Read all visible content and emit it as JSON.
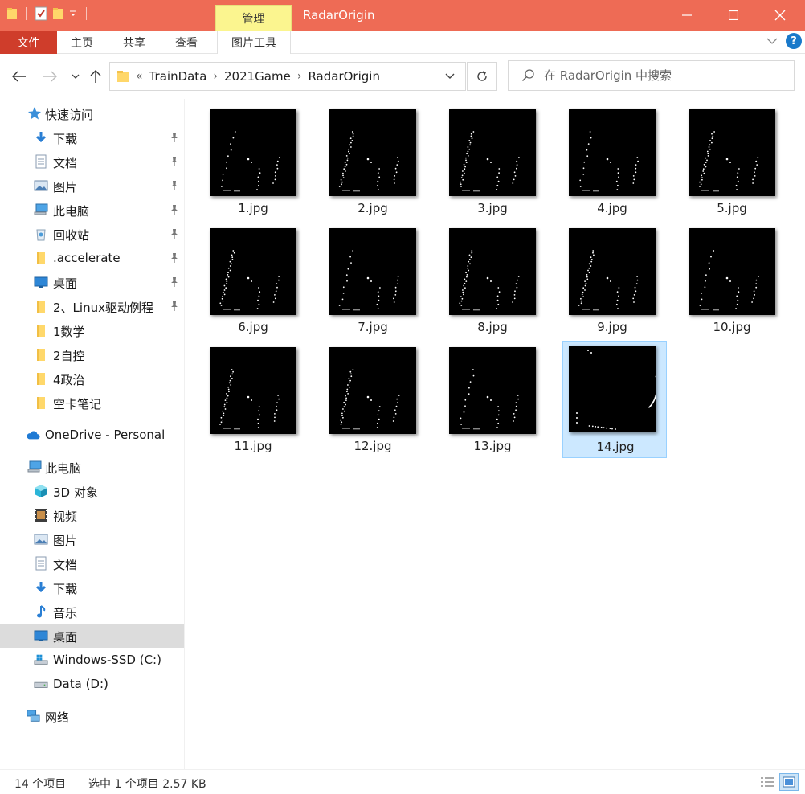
{
  "window": {
    "title": "RadarOrigin",
    "context_tab": "管理",
    "accent": "#ee6b55"
  },
  "ribbon": {
    "file_label": "文件",
    "tabs": [
      "主页",
      "共享",
      "查看",
      "图片工具"
    ]
  },
  "address": {
    "overflow": "«",
    "crumbs": [
      "TrainData",
      "2021Game",
      "RadarOrigin"
    ]
  },
  "search": {
    "placeholder": "在 RadarOrigin 中搜索"
  },
  "sidebar": {
    "items": [
      {
        "label": "快速访问",
        "icon": "star-icon"
      },
      {
        "label": "下载",
        "icon": "download-icon",
        "pinned": true
      },
      {
        "label": "文档",
        "icon": "document-icon",
        "pinned": true
      },
      {
        "label": "图片",
        "icon": "pictures-icon",
        "pinned": true
      },
      {
        "label": "此电脑",
        "icon": "computer-icon",
        "pinned": true
      },
      {
        "label": "回收站",
        "icon": "recycle-bin-icon",
        "pinned": true
      },
      {
        "label": ".accelerate",
        "icon": "folder-icon",
        "pinned": true
      },
      {
        "label": "桌面",
        "icon": "desktop-icon",
        "pinned": true
      },
      {
        "label": "2、Linux驱动例程",
        "icon": "folder-icon",
        "pinned": true
      },
      {
        "label": "1数学",
        "icon": "folder-icon"
      },
      {
        "label": "2自控",
        "icon": "folder-icon"
      },
      {
        "label": "4政治",
        "icon": "folder-icon"
      },
      {
        "label": "空卡笔记",
        "icon": "folder-icon"
      },
      {
        "label": "OneDrive - Personal",
        "icon": "cloud-icon"
      },
      {
        "label": "此电脑",
        "icon": "computer-icon"
      },
      {
        "label": "3D 对象",
        "icon": "cube-icon"
      },
      {
        "label": "视频",
        "icon": "video-icon"
      },
      {
        "label": "图片",
        "icon": "pictures-icon"
      },
      {
        "label": "文档",
        "icon": "document-icon"
      },
      {
        "label": "下载",
        "icon": "download-icon"
      },
      {
        "label": "音乐",
        "icon": "music-icon"
      },
      {
        "label": "桌面",
        "icon": "desktop-icon",
        "selected": true
      },
      {
        "label": "Windows-SSD (C:)",
        "icon": "windows-drive-icon"
      },
      {
        "label": "Data (D:)",
        "icon": "drive-icon"
      },
      {
        "label": "网络",
        "icon": "network-icon"
      }
    ]
  },
  "files": [
    {
      "name": "1.jpg"
    },
    {
      "name": "2.jpg"
    },
    {
      "name": "3.jpg"
    },
    {
      "name": "4.jpg"
    },
    {
      "name": "5.jpg"
    },
    {
      "name": "6.jpg"
    },
    {
      "name": "7.jpg"
    },
    {
      "name": "8.jpg"
    },
    {
      "name": "9.jpg"
    },
    {
      "name": "10.jpg"
    },
    {
      "name": "11.jpg"
    },
    {
      "name": "12.jpg"
    },
    {
      "name": "13.jpg"
    },
    {
      "name": "14.jpg",
      "selected": true
    }
  ],
  "status": {
    "count": "14 个项目",
    "selection": "选中 1 个项目  2.57 KB"
  }
}
